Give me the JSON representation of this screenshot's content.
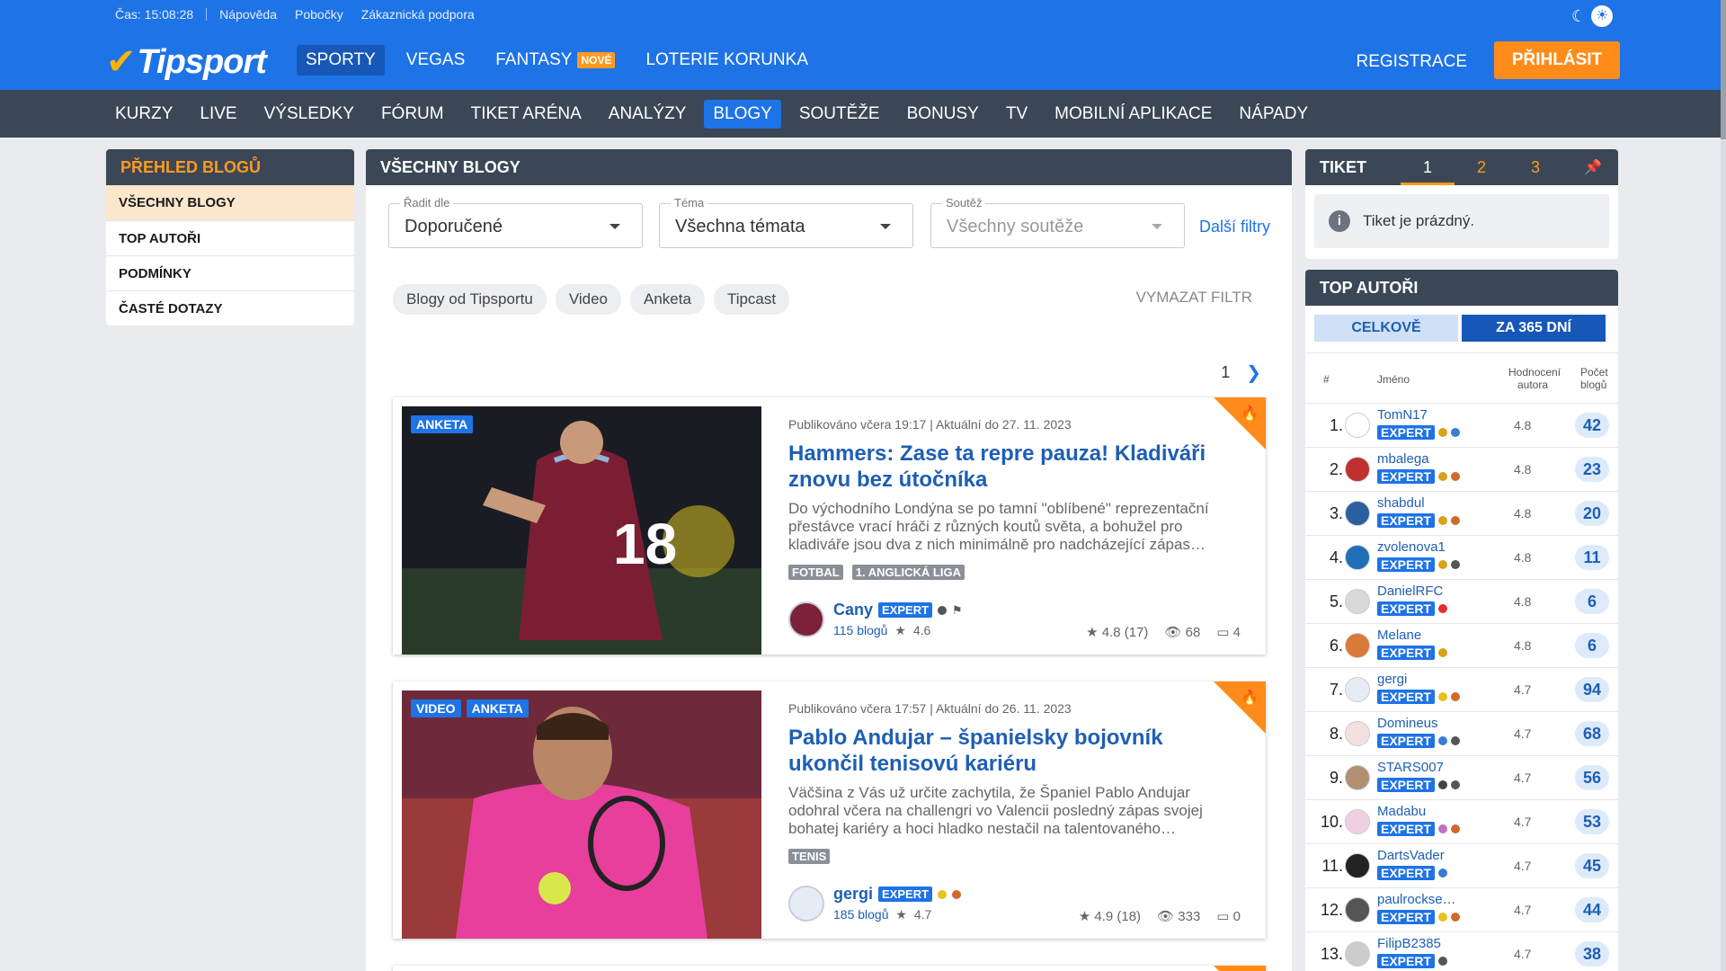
{
  "util": {
    "time": "Čas: 15:08:28",
    "help": "Nápověda",
    "branches": "Pobočky",
    "support": "Zákaznická podpora"
  },
  "brand": {
    "name": "Tipsport"
  },
  "mainnav": [
    {
      "label": "SPORTY",
      "active": true
    },
    {
      "label": "VEGAS"
    },
    {
      "label": "FANTASY",
      "badge": "NOVÉ"
    },
    {
      "label": "LOTERIE KORUNKA"
    }
  ],
  "auth": {
    "register": "REGISTRACE",
    "login": "PŘIHLÁSIT"
  },
  "subnav": [
    "KURZY",
    "LIVE",
    "VÝSLEDKY",
    "FÓRUM",
    "TIKET ARÉNA",
    "ANALÝZY",
    "BLOGY",
    "SOUTĚŽE",
    "BONUSY",
    "TV",
    "MOBILNÍ APLIKACE",
    "NÁPADY"
  ],
  "subnav_active": "BLOGY",
  "sidebar": {
    "title": "PŘEHLED BLOGŮ",
    "items": [
      "VŠECHNY BLOGY",
      "TOP AUTOŘI",
      "PODMÍNKY",
      "ČASTÉ DOTAZY"
    ]
  },
  "main": {
    "title": "VŠECHNY BLOGY",
    "filters": {
      "sort": {
        "label": "Řadit dle",
        "value": "Doporučené"
      },
      "topic": {
        "label": "Téma",
        "value": "Všechna témata"
      },
      "contest": {
        "label": "Soutěž",
        "value": "Všechny soutěže"
      },
      "more": "Další filtry"
    },
    "chips": [
      "Blogy od Tipsportu",
      "Video",
      "Anketa",
      "Tipcast"
    ],
    "clear": "VYMAZAT FILTR",
    "page": "1",
    "articles": [
      {
        "tags": [
          "ANKETA"
        ],
        "meta": "Publikováno včera 19:17  |  Aktuální do 27. 11. 2023",
        "title": "Hammers: Zase ta repre pauza! Kladiváři znovu bez útočníka",
        "desc": "Do východního Londýna se po tamní \"oblíbené\" reprezentační přestávce vrací hráči z různých koutů světa, a bohužel pro kladiváře jsou dva z nich minimálně pro nadcházející zápas…",
        "cats": [
          "FOTBAL",
          "1. ANGLICKÁ LIGA"
        ],
        "author": "Cany",
        "expert": "EXPERT",
        "blogs": "115 blogů",
        "author_rating": "4.6",
        "rating": "4.8 (17)",
        "views": "68",
        "comments": "4"
      },
      {
        "tags": [
          "VIDEO",
          "ANKETA"
        ],
        "meta": "Publikováno včera 17:57  |  Aktuální do 26. 11. 2023",
        "title": "Pablo Andujar – španielsky bojovník ukončil tenisovú kariéru",
        "desc": "Väčšina z Vás už určite zachytila, že Španiel Pablo Andujar odohral včera na challengri vo Valencii posledný zápas svojej bohatej kariéry a hoci hladko nestačil na talentovaného…",
        "cats": [
          "TENIS"
        ],
        "author": "gergi",
        "expert": "EXPERT",
        "blogs": "185 blogů",
        "author_rating": "4.7",
        "rating": "4.9 (18)",
        "views": "333",
        "comments": "0"
      }
    ]
  },
  "ticket": {
    "title": "TIKET",
    "tabs": [
      "1",
      "2",
      "3"
    ],
    "empty": "Tiket je prázdný."
  },
  "top": {
    "title": "TOP AUTOŘI",
    "toggle": [
      "CELKOVĚ",
      "ZA 365 DNÍ"
    ],
    "cols": {
      "rank": "#",
      "name": "Jméno",
      "score1": "Hodnocení",
      "score2": "autora",
      "count1": "Počet",
      "count2": "blogů"
    },
    "rows": [
      {
        "rank": "1.",
        "name": "TomN17",
        "score": "4.8",
        "count": "42"
      },
      {
        "rank": "2.",
        "name": "mbalega",
        "score": "4.8",
        "count": "23"
      },
      {
        "rank": "3.",
        "name": "shabdul",
        "score": "4.8",
        "count": "20"
      },
      {
        "rank": "4.",
        "name": "zvolenova1",
        "score": "4.8",
        "count": "11"
      },
      {
        "rank": "5.",
        "name": "DanielRFC",
        "score": "4.8",
        "count": "6"
      },
      {
        "rank": "6.",
        "name": "Melane",
        "score": "4.8",
        "count": "6"
      },
      {
        "rank": "7.",
        "name": "gergi",
        "score": "4.7",
        "count": "94"
      },
      {
        "rank": "8.",
        "name": "Domineus",
        "score": "4.7",
        "count": "68"
      },
      {
        "rank": "9.",
        "name": "STARS007",
        "score": "4.7",
        "count": "56"
      },
      {
        "rank": "10.",
        "name": "Madabu",
        "score": "4.7",
        "count": "53"
      },
      {
        "rank": "11.",
        "name": "DartsVader",
        "score": "4.7",
        "count": "45"
      },
      {
        "rank": "12.",
        "name": "paulrockse…",
        "score": "4.7",
        "count": "44"
      },
      {
        "rank": "13.",
        "name": "FilipB2385",
        "score": "4.7",
        "count": "38"
      }
    ],
    "expert": "EXPERT"
  },
  "colors": {
    "brand_blue": "#1e73e6",
    "orange": "#ff8c1a",
    "dark_nav": "#3b4756"
  }
}
